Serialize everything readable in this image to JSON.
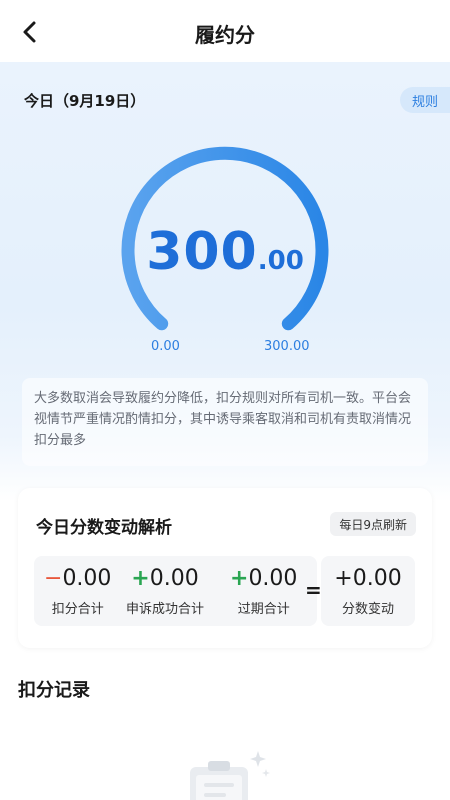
{
  "header": {
    "title": "履约分",
    "back_icon": "chevron-left-icon"
  },
  "summary": {
    "date_label": "今日（9月19日）",
    "rules_label": "规则",
    "score_int": "300",
    "score_dec": ".00",
    "gauge_min": "0.00",
    "gauge_max": "300.00",
    "score_value": 300,
    "score_max": 300,
    "accent_color": "#2d7fe0"
  },
  "notice": "大多数取消会导致履约分降低，扣分规则对所有司机一致。平台会视情节严重情况酌情扣分，其中诱导乘客取消和司机有责取消情况扣分最多",
  "analysis": {
    "title": "今日分数变动解析",
    "refresh_label": "每日9点刷新",
    "items": [
      {
        "sign": "−",
        "value": "0.00",
        "label": "扣分合计"
      },
      {
        "sign": "+",
        "value": "0.00",
        "label": "申诉成功合计"
      },
      {
        "sign": "+",
        "value": "0.00",
        "label": "过期合计"
      }
    ],
    "equals": "=",
    "result": {
      "value": "+0.00",
      "label": "分数变动"
    }
  },
  "records": {
    "title": "扣分记录"
  }
}
